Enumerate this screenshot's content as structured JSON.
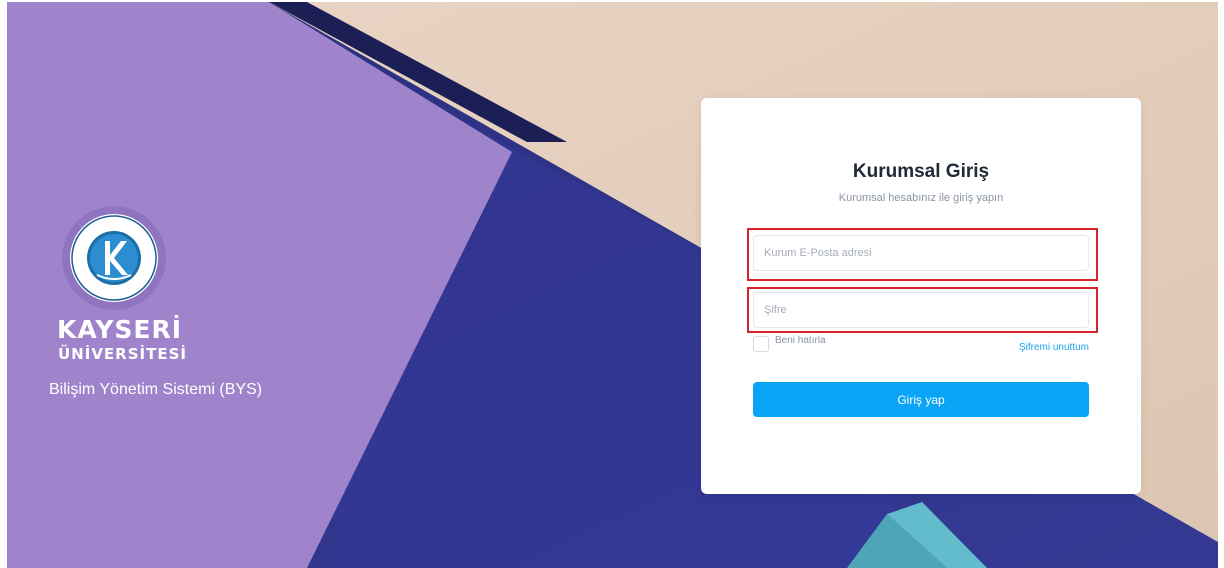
{
  "brand": {
    "name": "KAYSERİ",
    "subname": "ÜNİVERSİTESİ",
    "system": "Bilişim Yönetim Sistemi (BYS)",
    "logo_ring_text": "KAYSERİ ÜNİVERSİTESİ"
  },
  "login": {
    "title": "Kurumsal Giriş",
    "subtitle": "Kurumsal hesabınız ile giriş yapın",
    "email_placeholder": "Kurum E-Posta adresi",
    "password_placeholder": "Şifre",
    "remember_label": "Beni hatırla",
    "forgot_label": "Şifremi unuttum",
    "submit_label": "Giriş yap"
  },
  "colors": {
    "accent": "#0aa4f6",
    "link": "#1aa3ec",
    "highlight": "#d9232a",
    "lavender": "#a084cb",
    "navy": "#2f2f86",
    "peach": "#e6cfbd"
  }
}
